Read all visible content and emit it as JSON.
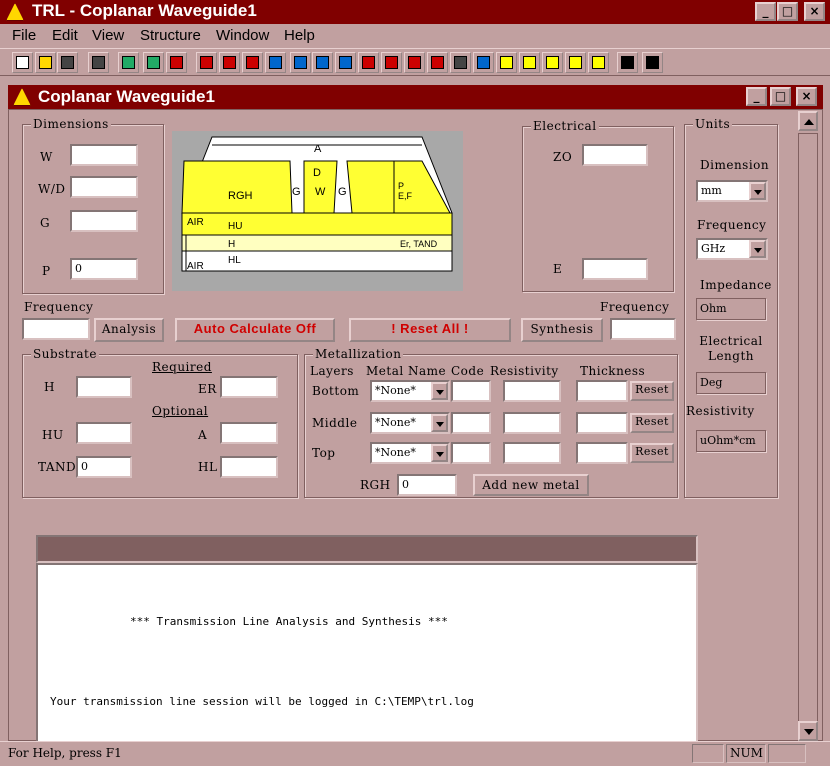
{
  "app": {
    "title": "TRL - Coplanar Waveguide1"
  },
  "menu": [
    "File",
    "Edit",
    "View",
    "Structure",
    "Window",
    "Help"
  ],
  "toolbar": {
    "icons": [
      "new-icon",
      "open-icon",
      "save-icon",
      "print-icon",
      "microstrip-icon",
      "stripline-icon",
      "coplanar-icon",
      "structure-icon-1",
      "structure-icon-2",
      "structure-icon-3",
      "structure-icon-4",
      "structure-icon-5",
      "structure-icon-6",
      "structure-icon-7",
      "structure-icon-8",
      "structure-icon-9",
      "structure-icon-10",
      "structure-icon-11",
      "structure-icon-12",
      "structure-icon-13",
      "structure-icon-14",
      "structure-icon-15",
      "structure-icon-16",
      "structure-icon-17",
      "structure-icon-18",
      "help-pointer-icon",
      "help-icon"
    ]
  },
  "doc": {
    "title": "Coplanar Waveguide1"
  },
  "dimensions": {
    "legend": "Dimensions",
    "labels": [
      "W",
      "W/D",
      "G",
      "P"
    ],
    "values": [
      "",
      "",
      "",
      "0"
    ]
  },
  "diagram": {
    "A": "A",
    "D": "D",
    "G": "G",
    "W": "W",
    "RGH": "RGH",
    "PEF": "P\nE,F",
    "AIR": "AIR",
    "HU": "HU",
    "H": "H",
    "ErTAND": "Er, TAND",
    "HL": "HL"
  },
  "electrical": {
    "legend": "Electrical",
    "z0": "ZO",
    "e": "E",
    "z0_value": "",
    "e_value": ""
  },
  "units": {
    "legend": "Units",
    "dimension_label": "Dimension",
    "dimension_value": "mm",
    "frequency_label": "Frequency",
    "frequency_value": "GHz",
    "impedance_label": "Impedance",
    "impedance_value": "Ohm",
    "electrical_length_label": "Electrical\nLength",
    "electrical_length_value": "Deg",
    "resistivity_label": "Resistivity",
    "resistivity_value": "uOhm*cm"
  },
  "controls": {
    "freq_left_label": "Frequency",
    "freq_right_label": "Frequency",
    "analysis": "Analysis",
    "auto_calc": "Auto Calculate Off",
    "reset_all": "!   Reset   All   !",
    "synthesis": "Synthesis",
    "freq_left_value": "",
    "freq_right_value": ""
  },
  "substrate": {
    "legend": "Substrate",
    "required": "Required",
    "optional": "Optional",
    "H": "H",
    "ER": "ER",
    "HU": "HU",
    "A": "A",
    "TAND": "TAND",
    "HL": "HL",
    "H_value": "",
    "ER_value": "",
    "HU_value": "",
    "A_value": "",
    "TAND_value": "0",
    "HL_value": ""
  },
  "metallization": {
    "legend": "Metallization",
    "headers": [
      "Layers",
      "Metal Name",
      "Code",
      "Resistivity",
      "Thickness"
    ],
    "rows": [
      {
        "layer": "Bottom",
        "metal": "*None*",
        "reset": "Reset"
      },
      {
        "layer": "Middle",
        "metal": "*None*",
        "reset": "Reset"
      },
      {
        "layer": "Top",
        "metal": "*None*",
        "reset": "Reset"
      }
    ],
    "rgh_label": "RGH",
    "rgh_value": "0",
    "add_metal": "Add new metal"
  },
  "log": {
    "line1": "*** Transmission Line Analysis and Synthesis ***",
    "line2": "Your transmission line session will be logged in C:\\TEMP\\trl.log"
  },
  "status": {
    "help": "For Help, press F1",
    "num": "NUM"
  }
}
